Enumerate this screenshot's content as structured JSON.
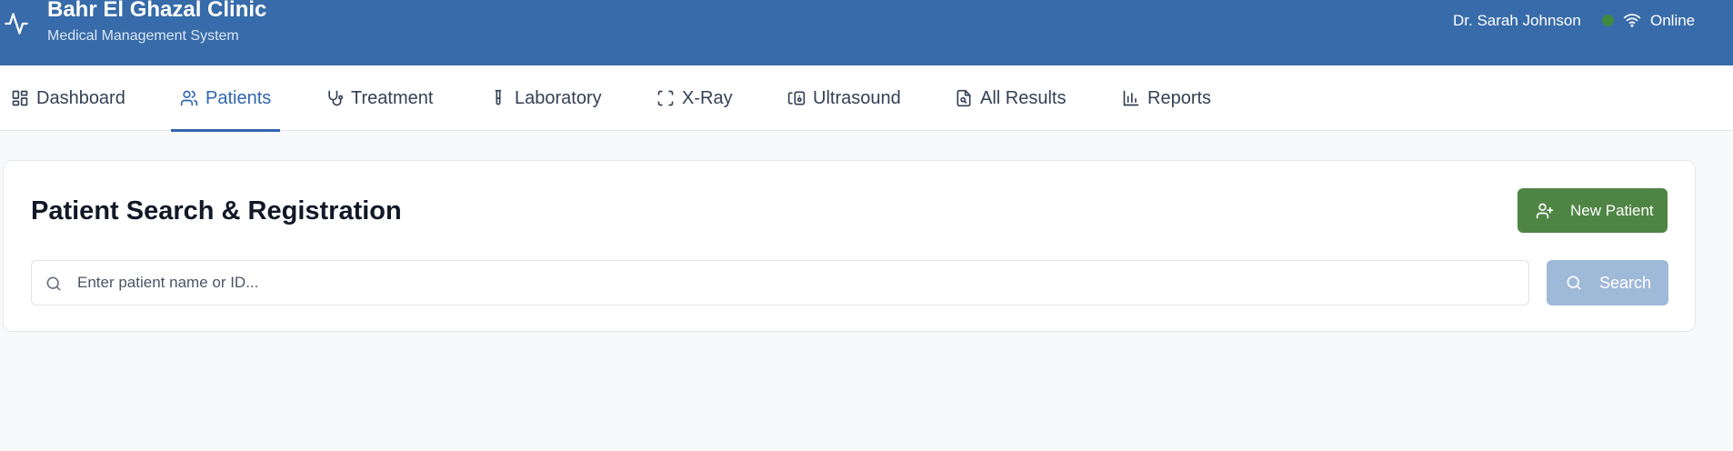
{
  "header": {
    "title": "Bahr El Ghazal Clinic",
    "subtitle": "Medical Management System",
    "user": "Dr. Sarah Johnson",
    "status": "Online",
    "colors": {
      "background": "#376ba9",
      "status_dot": "#3f8a3f"
    }
  },
  "nav": {
    "tabs": [
      {
        "label": "Dashboard",
        "icon": "dashboard-grid-icon",
        "active": false
      },
      {
        "label": "Patients",
        "icon": "users-icon",
        "active": true
      },
      {
        "label": "Treatment",
        "icon": "stethoscope-icon",
        "active": false
      },
      {
        "label": "Laboratory",
        "icon": "test-tube-icon",
        "active": false
      },
      {
        "label": "X-Ray",
        "icon": "scan-icon",
        "active": false
      },
      {
        "label": "Ultrasound",
        "icon": "monitor-speaker-icon",
        "active": false
      },
      {
        "label": "All Results",
        "icon": "file-search-icon",
        "active": false
      },
      {
        "label": "Reports",
        "icon": "bar-chart-icon",
        "active": false
      }
    ],
    "active_color": "#2f67ad"
  },
  "main": {
    "title": "Patient Search & Registration",
    "new_patient_label": "New Patient",
    "search": {
      "placeholder": "Enter patient name or ID...",
      "value": "",
      "button_label": "Search"
    },
    "colors": {
      "new_patient": "#4f8544",
      "search_button": "#9fb9d9"
    }
  }
}
